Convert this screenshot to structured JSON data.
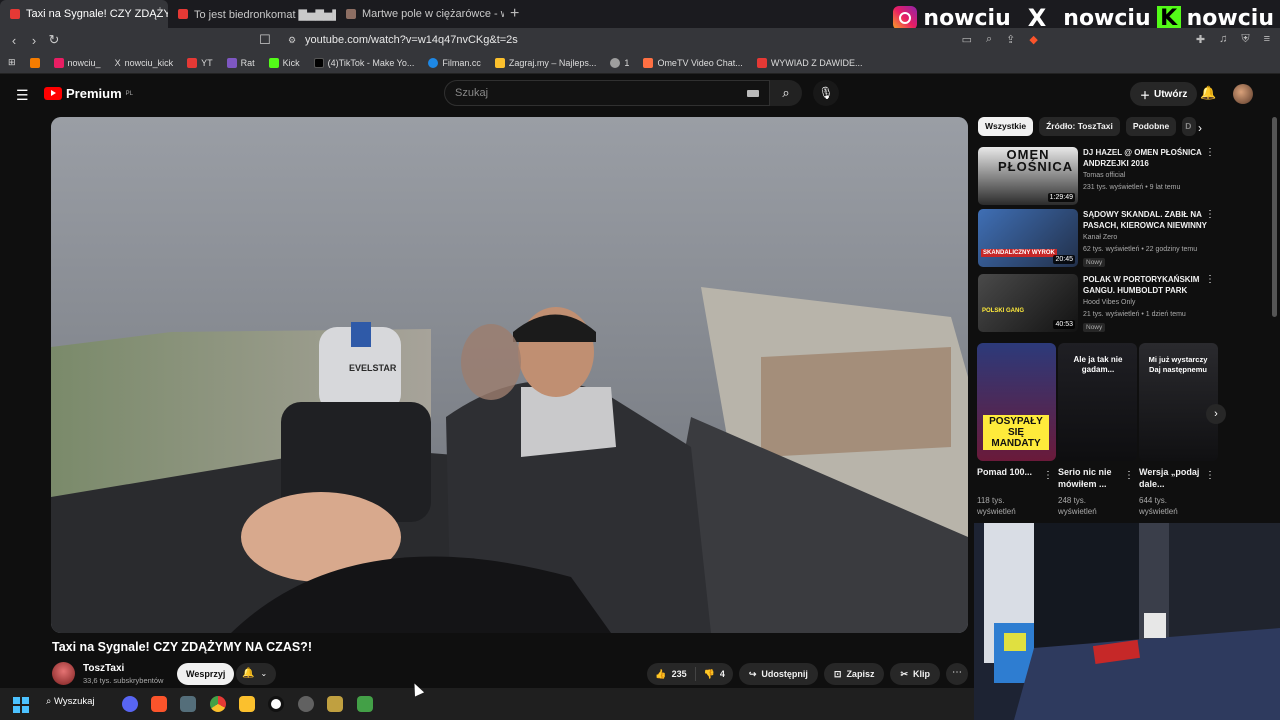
{
  "browser": {
    "tabs": [
      {
        "label": "Taxi na Sygnale! CZY ZDĄŻYM",
        "active": true
      },
      {
        "label": "To jest biedronkomat ▇▅▇▅▇",
        "active": false
      },
      {
        "label": "Martwe pole w ciężarówce - w pr",
        "active": false
      }
    ],
    "url": "youtube.com/watch?v=w14q47nvCKg&t=2s",
    "bookmarks": [
      "nowciu_",
      "nowciu_kick",
      "YT",
      "Rat",
      "Kick",
      "(4)TikTok - Make Yo...",
      "Filman.cc",
      "Zagraj.my – Najleps...",
      "1",
      "OmeTV Video Chat...",
      "WYWIAD Z DAWIDE..."
    ]
  },
  "overlay": {
    "instagram": "nowciu_",
    "x": "_nowciu",
    "kick": "nowciu",
    "kick_letter": "K",
    "x_letter": "X"
  },
  "yt": {
    "logo": "Premium",
    "logo_sup": "PL",
    "search_placeholder": "Szukaj",
    "create_label": "Utwórz"
  },
  "video": {
    "title": "Taxi na Sygnale! CZY ZDĄŻYMY NA CZAS?!",
    "channel": "ToszTaxi",
    "subscribers": "33,6 tys. subskrybentów",
    "support_label": "Wesprzyj",
    "likes": "235",
    "dislikes": "4",
    "share_label": "Udostępnij",
    "save_label": "Zapisz",
    "clip_label": "Klip",
    "seat_logo": "EVELSTAR"
  },
  "chips": [
    "Wszystkie",
    "Źródło: ToszTaxi",
    "Podobne",
    "D"
  ],
  "related": [
    {
      "title": "DJ HAZEL @ OMEN PŁOŚNICA ANDRZEJKI 2016",
      "channel": "Tomas official",
      "meta": "231 tys. wyświetleń • 9 lat temu",
      "duration": "1:29:49",
      "new": "",
      "thumb_text": "OMEN PŁOŚNICA"
    },
    {
      "title": "SĄDOWY SKANDAL. ZABIŁ NA PASACH, KIEROWCA NIEWINNY",
      "channel": "Kanał Zero",
      "meta": "62 tys. wyświetleń • 22 godziny temu",
      "duration": "20:45",
      "new": "Nowy",
      "thumb_text": "SKANDALICZNY WYROK"
    },
    {
      "title": "POLAK W PORTORYKAŃSKIM GANGU. HUMBOLDT PARK",
      "channel": "Hood Vibes Only",
      "meta": "21 tys. wyświetleń • 1 dzień temu",
      "duration": "40:53",
      "new": "Nowy",
      "thumb_text": "POLSKI GANG"
    }
  ],
  "shorts": [
    {
      "title": "Pomad 100...",
      "views": "118 tys.",
      "views2": "wyświetleń",
      "thumb_text": "POSYPAŁY SIĘ MANDATY"
    },
    {
      "title": "Serio nic nie mówiłem ...",
      "views": "248 tys.",
      "views2": "wyświetleń",
      "thumb_text": "Ale ja tak nie gadam..."
    },
    {
      "title": "Wersja „podaj dale...",
      "views": "644 tys.",
      "views2": "wyświetleń",
      "thumb_text": "Mi już wystarczy Daj następnemu"
    }
  ],
  "taskbar": {
    "search_label": "Wyszukaj"
  },
  "colors": {
    "accent": "#ff0000",
    "bg": "#0f0f0f",
    "chip": "#272727"
  }
}
